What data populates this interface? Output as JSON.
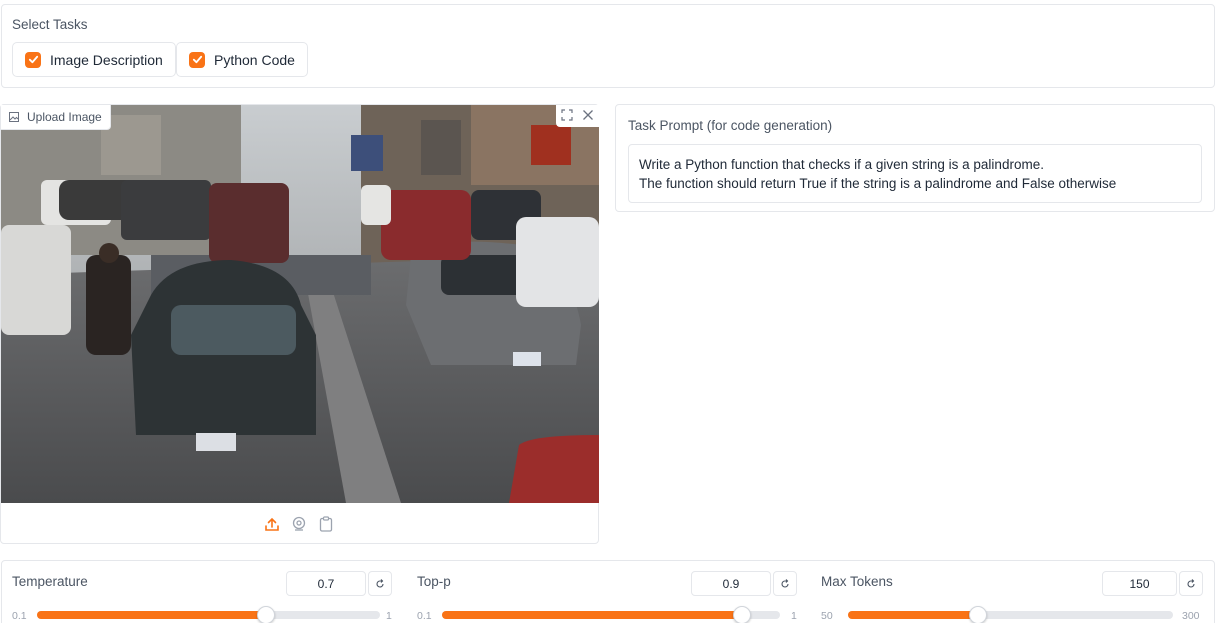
{
  "tasks": {
    "title": "Select Tasks",
    "options": [
      {
        "label": "Image Description",
        "checked": true
      },
      {
        "label": "Python Code",
        "checked": true
      }
    ]
  },
  "image_panel": {
    "badge": "Upload Image",
    "controls": [
      "fullscreen-icon",
      "close-icon"
    ],
    "sources": [
      "upload-icon",
      "webcam-icon",
      "clipboard-icon"
    ]
  },
  "prompt": {
    "title": "Task Prompt (for code generation)",
    "line1": "Write a Python function that checks if a given string is a palindrome.",
    "line2": "The function should return True if the string is a palindrome and False otherwise"
  },
  "sliders": [
    {
      "name": "Temperature",
      "value": "0.7",
      "min": "0.1",
      "max": "1",
      "fraction": 0.667
    },
    {
      "name": "Top-p",
      "value": "0.9",
      "min": "0.1",
      "max": "1",
      "fraction": 0.889
    },
    {
      "name": "Max Tokens",
      "value": "150",
      "min": "50",
      "max": "300",
      "fraction": 0.4
    }
  ],
  "colors": {
    "accent": "#f97316",
    "border": "#e5e7eb"
  }
}
